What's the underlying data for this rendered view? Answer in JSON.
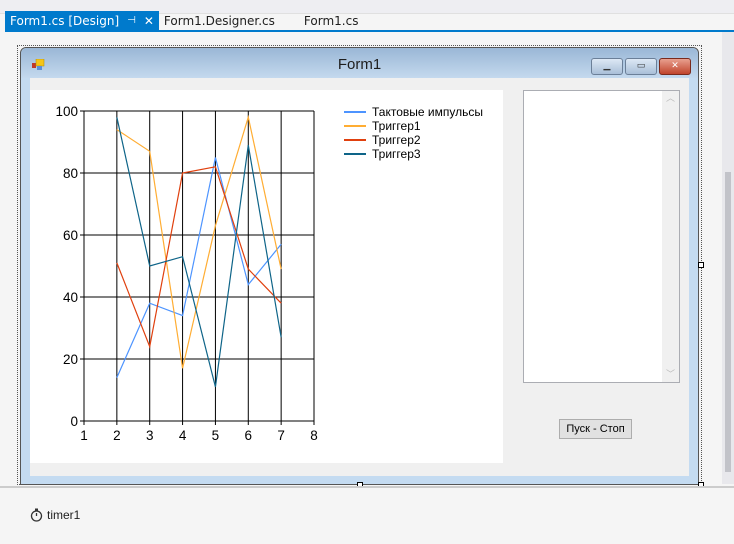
{
  "tabs": [
    {
      "label": "Form1.cs [Design]",
      "active": true
    },
    {
      "label": "Form1.Designer.cs"
    },
    {
      "label": "Form1.cs"
    }
  ],
  "pin_glyph": "⊣",
  "close_glyph": "✕",
  "form": {
    "title": "Form1"
  },
  "button": {
    "label": "Пуск - Стоп"
  },
  "tray": {
    "component": "timer1"
  },
  "chart_data": {
    "type": "line",
    "x": [
      2,
      3,
      4,
      5,
      6,
      7
    ],
    "xlim": [
      1,
      8
    ],
    "ylim": [
      0,
      100
    ],
    "xticks": [
      "1",
      "2",
      "3",
      "4",
      "5",
      "6",
      "7",
      "8"
    ],
    "yticks": [
      "0",
      "20",
      "40",
      "60",
      "80",
      "100"
    ],
    "grid": true,
    "legend": "top-right",
    "series": [
      {
        "name": "Тактовые импульсы",
        "color": "#4d94ff",
        "values": [
          14,
          38,
          34,
          85,
          44,
          57
        ]
      },
      {
        "name": "Триггер1",
        "color": "#ffad33",
        "values": [
          94,
          87,
          17,
          63,
          98,
          49
        ]
      },
      {
        "name": "Триггер2",
        "color": "#e0400e",
        "values": [
          51,
          24,
          80,
          82,
          49,
          38
        ]
      },
      {
        "name": "Триггер3",
        "color": "#0e6488",
        "values": [
          98,
          50,
          53,
          11,
          89,
          27
        ]
      }
    ]
  }
}
